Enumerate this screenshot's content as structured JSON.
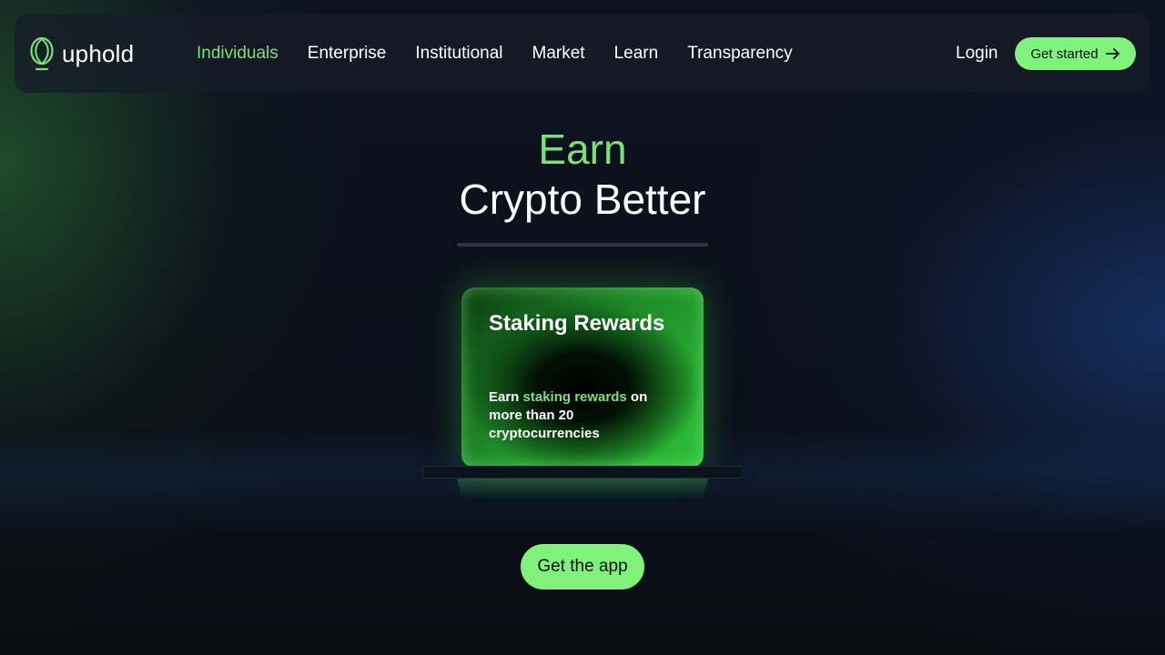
{
  "brand": {
    "name": "uphold",
    "accent_color": "#7ce07a",
    "button_color": "#80f27c",
    "logo_icon": "uphold-leaf-icon"
  },
  "nav": {
    "items": [
      {
        "label": "Individuals",
        "active": true
      },
      {
        "label": "Enterprise",
        "active": false
      },
      {
        "label": "Institutional",
        "active": false
      },
      {
        "label": "Market",
        "active": false
      },
      {
        "label": "Learn",
        "active": false
      },
      {
        "label": "Transparency",
        "active": false
      }
    ],
    "login_label": "Login",
    "cta_label": "Get started",
    "cta_icon": "arrow-right-icon"
  },
  "hero": {
    "line1": "Earn",
    "line2": "Crypto Better"
  },
  "card": {
    "title": "Staking Rewards",
    "body_prefix": "Earn ",
    "body_highlight": "staking rewards",
    "body_suffix": " on more than 20 cryptocurrencies"
  },
  "app_button": {
    "label": "Get the app"
  }
}
